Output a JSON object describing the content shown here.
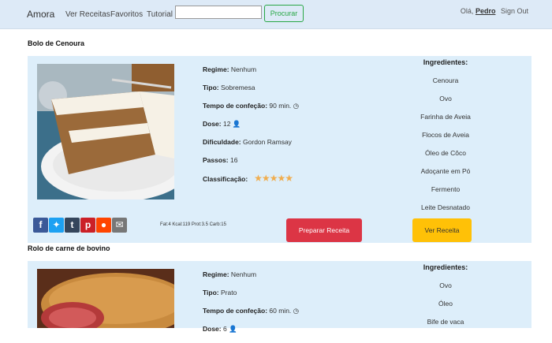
{
  "nav": {
    "brand": "Amora",
    "links": [
      "Ver Receitas",
      "Favoritos",
      "Tutorial"
    ],
    "search_value": "",
    "search_button": "Procurar",
    "greeting": "Olá,",
    "username": "Pedro",
    "signout": "Sign Out"
  },
  "labels": {
    "regime": "Regime:",
    "tipo": "Tipo:",
    "tempo": "Tempo de confeção:",
    "dose": "Dose:",
    "dificuldade": "Dificuldade:",
    "passos": "Passos:",
    "classificacao": "Classificação:",
    "ingredientes": "Ingredientes:"
  },
  "recipes": [
    {
      "title": "Bolo de Cenoura",
      "regime": "Nenhum",
      "tipo": "Sobremesa",
      "tempo": "90 min.",
      "dose": "12",
      "dificuldade": "Gordon Ramsay",
      "passos": "16",
      "rating": 4.5,
      "stars": "★★★★★",
      "ingredients": [
        "Cenoura",
        "Ovo",
        "Farinha de Aveia",
        "Flocos de Aveia",
        "Óleo de Côco",
        "Adoçante em Pó",
        "Fermento",
        "Leite Desnatado"
      ],
      "nutrition": "Fat:4 Kcal:119 Prot:3.5 Carb:15",
      "prepare_button": "Preparar Receita",
      "view_button": "Ver Receita"
    },
    {
      "title": "Rolo de carne de bovino",
      "regime": "Nenhum",
      "tipo": "Prato",
      "tempo": "60 min.",
      "dose": "6",
      "ingredients": [
        "Ovo",
        "Óleo",
        "Bife de vaca"
      ]
    }
  ],
  "social_icons": [
    "facebook-icon",
    "twitter-icon",
    "tumblr-icon",
    "pinterest-icon",
    "reddit-icon",
    "email-icon"
  ],
  "colors": {
    "navbar": "#ddeaf7",
    "card": "#ddeefa",
    "prepare": "#dc3545",
    "view": "#ffc107",
    "search": "#28a745",
    "stars": "#f0ad4e"
  }
}
